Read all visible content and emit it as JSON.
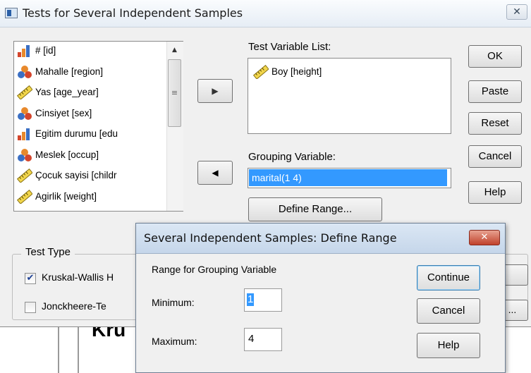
{
  "main_dialog": {
    "title": "Tests for Several Independent Samples",
    "close_glyph": "✕",
    "variables": [
      {
        "label": "# [id]",
        "icon": "ordinal-bar-icon"
      },
      {
        "label": "Mahalle [region]",
        "icon": "nominal-balls-icon"
      },
      {
        "label": "Yas [age_year]",
        "icon": "scale-ruler-icon"
      },
      {
        "label": "Cinsiyet [sex]",
        "icon": "nominal-balls-icon"
      },
      {
        "label": "Egitim durumu [edu",
        "icon": "ordinal-bar-icon"
      },
      {
        "label": "Meslek [occup]",
        "icon": "nominal-balls-icon"
      },
      {
        "label": "Çocuk sayisi [childr",
        "icon": "scale-ruler-icon"
      },
      {
        "label": "Agirlik [weight]",
        "icon": "scale-ruler-icon"
      }
    ],
    "move_right_glyph": "▶",
    "move_left_glyph": "◀",
    "test_variable_label": "Test Variable List:",
    "test_variables": [
      {
        "label": "Boy [height]",
        "icon": "scale-ruler-icon"
      }
    ],
    "grouping_label": "Grouping Variable:",
    "grouping_value": "marital(1 4)",
    "define_range_label": "Define Range...",
    "buttons": {
      "ok": "OK",
      "paste": "Paste",
      "reset": "Reset",
      "cancel": "Cancel",
      "help": "Help"
    },
    "test_type_label": "Test Type",
    "tests": [
      {
        "label": "Kruskal-Wallis H",
        "checked": true
      },
      {
        "label": "Jonckheere-Te",
        "checked": false
      }
    ],
    "obscured_button_2": "..."
  },
  "range_dialog": {
    "title": "Several Independent Samples: Define Range",
    "close_glyph": "✕",
    "group_label": "Range for Grouping Variable",
    "minimum_label": "Minimum:",
    "maximum_label": "Maximum:",
    "minimum_value": "1",
    "maximum_value": "4",
    "continue_label": "Continue",
    "cancel_label": "Cancel",
    "help_label": "Help"
  },
  "background_doc": {
    "heading_fragment": "Kru"
  },
  "colors": {
    "selection": "#3399ff",
    "dialog_bg": "#f0f0f0",
    "close_red": "#c0422c"
  }
}
